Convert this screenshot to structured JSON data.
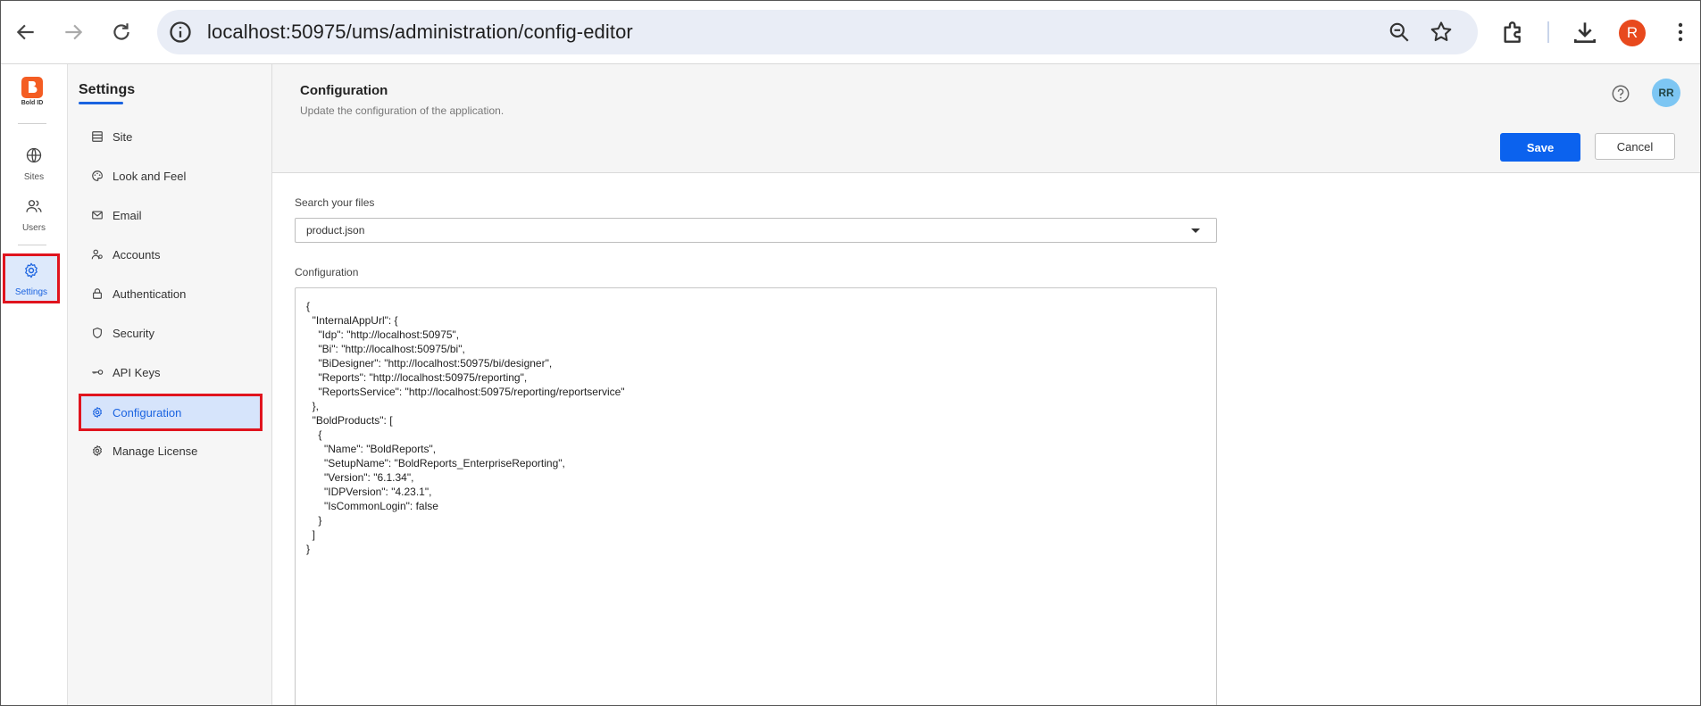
{
  "browser": {
    "url": "localhost:50975/ums/administration/config-editor",
    "profile_initial": "R"
  },
  "rail": {
    "logo_text": "Bold ID",
    "items": [
      {
        "label": "Sites",
        "icon": "globe-icon"
      },
      {
        "label": "Users",
        "icon": "users-icon"
      },
      {
        "label": "Settings",
        "icon": "gear-icon"
      }
    ]
  },
  "settings_nav": {
    "title": "Settings",
    "items": [
      {
        "label": "Site",
        "icon": "site-icon"
      },
      {
        "label": "Look and Feel",
        "icon": "palette-icon"
      },
      {
        "label": "Email",
        "icon": "mail-icon"
      },
      {
        "label": "Accounts",
        "icon": "accounts-icon"
      },
      {
        "label": "Authentication",
        "icon": "lock-icon"
      },
      {
        "label": "Security",
        "icon": "shield-icon"
      },
      {
        "label": "API Keys",
        "icon": "key-icon"
      },
      {
        "label": "Configuration",
        "icon": "gear-icon"
      },
      {
        "label": "Manage License",
        "icon": "license-icon"
      }
    ],
    "active_item": "Configuration"
  },
  "header": {
    "title": "Configuration",
    "subtitle": "Update the configuration of the application.",
    "avatar_initials": "RR",
    "save_label": "Save",
    "cancel_label": "Cancel"
  },
  "main": {
    "search_label": "Search your files",
    "selected_file": "product.json",
    "config_label": "Configuration",
    "code_lines": [
      "{",
      "  \"InternalAppUrl\": {",
      "    \"Idp\": \"http://localhost:50975\",",
      "    \"Bi\": \"http://localhost:50975/bi\",",
      "    \"BiDesigner\": \"http://localhost:50975/bi/designer\",",
      "    \"Reports\": \"http://localhost:50975/reporting\",",
      "    \"ReportsService\": \"http://localhost:50975/reporting/reportservice\"",
      "  },",
      "  \"BoldProducts\": [",
      "    {",
      "      \"Name\": \"BoldReports\",",
      "      \"SetupName\": \"BoldReports_EnterpriseReporting\",",
      "      \"Version\": \"6.1.34\",",
      "      \"IDPVersion\": \"4.23.1\",",
      "      \"IsCommonLogin\": false",
      "    }",
      "  ]",
      "}"
    ]
  },
  "colors": {
    "accent": "#0b62ee",
    "brand": "#f45d23",
    "highlight": "#e0141e"
  }
}
